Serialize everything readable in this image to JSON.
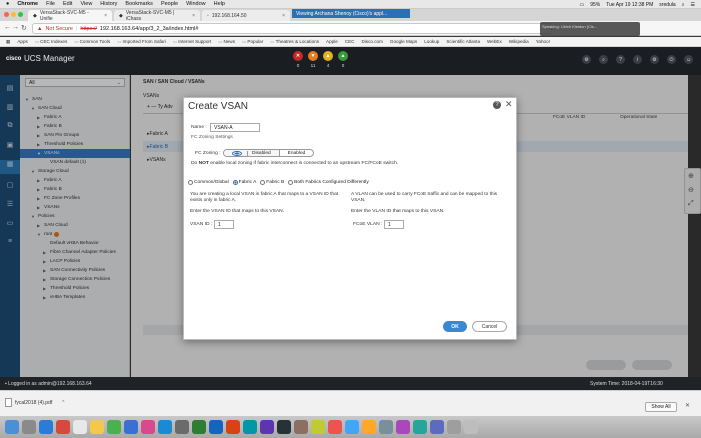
{
  "menubar": {
    "apple": "",
    "items": [
      "Chrome",
      "File",
      "Edit",
      "View",
      "History",
      "Bookmarks",
      "People",
      "Window",
      "Help"
    ],
    "battery": "95%",
    "clock": "Tue Apr 19 12:38 PM",
    "user": "sredula"
  },
  "notification": "Viewing Archana Shenoy (Cisco)'s appl...",
  "tabs": [
    {
      "label": "VersaStack-SVC-M5 - Unifie"
    },
    {
      "label": "VersaStack-SVC-M5 | iChass"
    },
    {
      "label": "192.168.164.50"
    }
  ],
  "address": {
    "warning": "Not Secure",
    "scheme": "https://",
    "url": "192.168.163.64/app/3_2_3a/index.html#"
  },
  "speaking": "Speaking: Ulrich Kleidon (Cis... ",
  "bookmarks": [
    "Apps",
    "CEC Indexes",
    "Common Tools",
    "Imported From Safari",
    "Internet Support",
    "News",
    "Popular",
    "Theatres & Locations",
    "Apple",
    "CEC",
    "Disco.com",
    "Google Maps",
    "Lookup",
    "Scientific Atlanta",
    "WebEx",
    "Wikipedia",
    "Yahoo!"
  ],
  "ucs": {
    "brand": "cisco",
    "title": "UCS Manager",
    "faults": [
      {
        "count": "0",
        "color": "#c62828",
        "icon": "critical-fault-icon"
      },
      {
        "count": "11",
        "color": "#e57c1f",
        "icon": "major-fault-icon"
      },
      {
        "count": "4",
        "color": "#e0b21d",
        "icon": "minor-fault-icon"
      },
      {
        "count": "0",
        "color": "#3a9a3a",
        "icon": "warning-fault-icon"
      }
    ]
  },
  "nav": {
    "filter": "All",
    "tree": [
      {
        "label": "SAN",
        "indent": 0,
        "tw": "▼"
      },
      {
        "label": "SAN Cloud",
        "indent": 1,
        "tw": "▼"
      },
      {
        "label": "Fabric A",
        "indent": 2,
        "tw": "▶"
      },
      {
        "label": "Fabric B",
        "indent": 2,
        "tw": "▶"
      },
      {
        "label": "SAN Pin Groups",
        "indent": 2,
        "tw": "▶"
      },
      {
        "label": "Threshold Policies",
        "indent": 2,
        "tw": "▶"
      },
      {
        "label": "VSANs",
        "indent": 2,
        "tw": "▼",
        "selected": true
      },
      {
        "label": "VSAN default (1)",
        "indent": 3,
        "tw": ""
      },
      {
        "label": "Storage Cloud",
        "indent": 1,
        "tw": "▼"
      },
      {
        "label": "Fabric A",
        "indent": 2,
        "tw": "▶"
      },
      {
        "label": "Fabric B",
        "indent": 2,
        "tw": "▶"
      },
      {
        "label": "FC Zone Profiles",
        "indent": 2,
        "tw": "▶"
      },
      {
        "label": "VSANs",
        "indent": 2,
        "tw": "▶"
      },
      {
        "label": "Policies",
        "indent": 1,
        "tw": "▼"
      },
      {
        "label": "SAN Cloud",
        "indent": 2,
        "tw": "▶"
      },
      {
        "label": "root",
        "indent": 2,
        "tw": "▼",
        "badge": true
      },
      {
        "label": "Default vHBA Behavior",
        "indent": 3,
        "tw": ""
      },
      {
        "label": "Fibre Channel Adapter Policies",
        "indent": 3,
        "tw": "▶"
      },
      {
        "label": "LACP Policies",
        "indent": 3,
        "tw": "▶"
      },
      {
        "label": "SAN Connectivity Policies",
        "indent": 3,
        "tw": "▶"
      },
      {
        "label": "Storage Connection Policies",
        "indent": 3,
        "tw": "▶"
      },
      {
        "label": "Threshold Policies",
        "indent": 3,
        "tw": "▶"
      },
      {
        "label": "vHBA Templates",
        "indent": 3,
        "tw": "▶"
      }
    ]
  },
  "main": {
    "breadcrumb": "SAN / SAN Cloud / VSANs",
    "heading": "VSANs",
    "toolbar": "+  —  Ty Adv",
    "rows": [
      "Fabric A",
      "Fabric B",
      "VSANs"
    ],
    "columns": [
      "FCoE VLAN ID",
      "Operational State"
    ]
  },
  "dialog": {
    "title": "Create VSAN",
    "name_label": "Name :",
    "name_value": "VSAN-A",
    "fc_zoning_settings": "FC Zoning Settings",
    "fc_zoning_label": "FC Zoning :",
    "fc_zoning_options": [
      "Disabled",
      "Enabled"
    ],
    "warning_bold": "NOT",
    "warning_pre": "Do ",
    "warning_post": " enable local zoning if fabric interconnect is connected to an upstream FC/FCoE switch.",
    "scope_options": [
      "Common/Global",
      "Fabric A",
      "Fabric B",
      "Both Fabrics Configured Differently"
    ],
    "left_desc": "You are creating a local VSAN in fabric A that maps to a VSAN ID that exists only in fabric A.",
    "left_enter": "Enter the VSAN ID that maps to this VSAN.",
    "vsan_id_label": "VSAN ID :",
    "vsan_id_value": "1",
    "right_desc": "A VLAN can be used to carry FCoE traffic and can be mapped to this VSAN.",
    "right_enter": "Enter the VLAN ID that maps to this VSAN.",
    "fcoe_label": "FCoE VLAN :",
    "fcoe_value": "1",
    "ok": "OK",
    "cancel": "Cancel"
  },
  "status": {
    "left": "Logged in as admin@192.168.163.64",
    "right": "System Time: 2018-04-19T16:30"
  },
  "downloads": {
    "file": "fycal2018 (4).pdf",
    "show_all": "Show All"
  }
}
